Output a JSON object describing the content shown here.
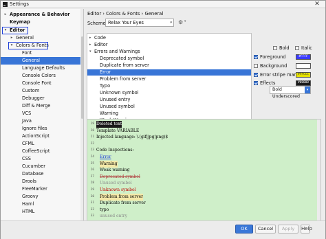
{
  "window": {
    "title": "Settings",
    "close_glyph": "✕"
  },
  "sidebar": {
    "items": [
      {
        "label": "Appearance & Behavior",
        "bold": true,
        "arrow": "▸"
      },
      {
        "label": "Keymap",
        "bold": true
      },
      {
        "label": "Editor",
        "bold": true,
        "arrow": "▾",
        "outlined": true
      },
      {
        "label": "General",
        "arrow": "▸"
      },
      {
        "label": "Colors & Fonts",
        "arrow": "▾",
        "outlined": true
      },
      {
        "label": "Font"
      },
      {
        "label": "General",
        "selected": true
      },
      {
        "label": "Language Defaults"
      },
      {
        "label": "Console Colors"
      },
      {
        "label": "Console Font"
      },
      {
        "label": "Custom"
      },
      {
        "label": "Debugger"
      },
      {
        "label": "Diff & Merge"
      },
      {
        "label": "VCS"
      },
      {
        "label": "Java"
      },
      {
        "label": "Ignore files"
      },
      {
        "label": "ActionScript"
      },
      {
        "label": "CFML"
      },
      {
        "label": "CoffeeScript"
      },
      {
        "label": "CSS"
      },
      {
        "label": "Cucumber"
      },
      {
        "label": "Database"
      },
      {
        "label": "Drools"
      },
      {
        "label": "FreeMarker"
      },
      {
        "label": "Groovy"
      },
      {
        "label": "Haml"
      },
      {
        "label": "HTML"
      }
    ]
  },
  "content": {
    "breadcrumb": "Editor › Colors & Fonts › General",
    "scheme_label": "Scheme:",
    "scheme_value": "Relax Your Eyes",
    "gear_icon": "⚙",
    "dropdown_glyph": "▾"
  },
  "attributes_tree": [
    {
      "label": "Code",
      "arrow": "▸"
    },
    {
      "label": "Editor",
      "arrow": "▸"
    },
    {
      "label": "Errors and Warnings",
      "arrow": "▾"
    },
    {
      "label": "Deprecated symbol"
    },
    {
      "label": "Duplicate from server"
    },
    {
      "label": "Error",
      "selected": true
    },
    {
      "label": "Problem from server"
    },
    {
      "label": "Typo"
    },
    {
      "label": "Unknown symbol"
    },
    {
      "label": "Unused entry"
    },
    {
      "label": "Unused symbol"
    },
    {
      "label": "Warning"
    },
    {
      "label": "Weak Warning"
    }
  ],
  "attribute_panel": {
    "bold_label": "Bold",
    "bold_checked": false,
    "italic_label": "Italic",
    "italic_checked": false,
    "rows": [
      {
        "label": "Foreground",
        "checked": true,
        "swatch": "#FFFF",
        "color": "#3a3aff",
        "text_color": "#ffffff"
      },
      {
        "label": "Background",
        "checked": false,
        "swatch": "",
        "color": "#ffffff",
        "text_color": "#ffffff"
      },
      {
        "label": "Error stripe mark",
        "checked": true,
        "swatch": "#FFCCC",
        "color": "#e4e000",
        "text_color": "#333333"
      },
      {
        "label": "Effects",
        "checked": true,
        "swatch": "#00000",
        "color": "#1a1a1a",
        "text_color": "#ffffff"
      }
    ],
    "effect_type": "Bold Underscored"
  },
  "preview": {
    "lines": [
      {
        "n": "19",
        "text": "Deleted text",
        "color": "#ffffff",
        "bg": "#1a1a1a",
        "indent": false
      },
      {
        "n": "20",
        "text": "Template VARIABLE",
        "color": "#000000",
        "bg": "",
        "indent": false
      },
      {
        "n": "21",
        "text": "Injected language: \\.(gif|jpg|png)$",
        "color": "#000000",
        "bg": "",
        "indent": false
      },
      {
        "n": "22",
        "text": "",
        "color": "#000000",
        "bg": "",
        "indent": false
      },
      {
        "n": "23",
        "text": "Code Inspections:",
        "color": "#000000",
        "bg": "",
        "indent": false
      },
      {
        "n": "24",
        "text": "Error",
        "color": "#1f3fd9",
        "bg": "",
        "indent": true,
        "underline": true
      },
      {
        "n": "25",
        "text": "Warning",
        "color": "#000000",
        "bg": "#f3e8a8",
        "indent": true
      },
      {
        "n": "26",
        "text": "Weak warning",
        "color": "#000000",
        "bg": "",
        "indent": true
      },
      {
        "n": "27",
        "text": "Deprecated symbol",
        "color": "#b04040",
        "bg": "",
        "indent": true,
        "strike": true
      },
      {
        "n": "28",
        "text": "Unused symbol",
        "color": "#8a8a8a",
        "bg": "",
        "indent": true
      },
      {
        "n": "29",
        "text": "Unknown symbol",
        "color": "#c00000",
        "bg": "",
        "indent": true
      },
      {
        "n": "30",
        "text": "Problem from server",
        "color": "#000000",
        "bg": "#f3e8a8",
        "indent": true
      },
      {
        "n": "31",
        "text": "Duplicate from server",
        "color": "#000000",
        "bg": "",
        "indent": true
      },
      {
        "n": "32",
        "text": "typo",
        "color": "#000000",
        "bg": "",
        "indent": true
      },
      {
        "n": "33",
        "text": "unused entry",
        "color": "#8a8a8a",
        "bg": "",
        "indent": true
      }
    ]
  },
  "footer": {
    "ok": "OK",
    "cancel": "Cancel",
    "apply": "Apply",
    "help": "Help",
    "help_glyph": "?"
  }
}
